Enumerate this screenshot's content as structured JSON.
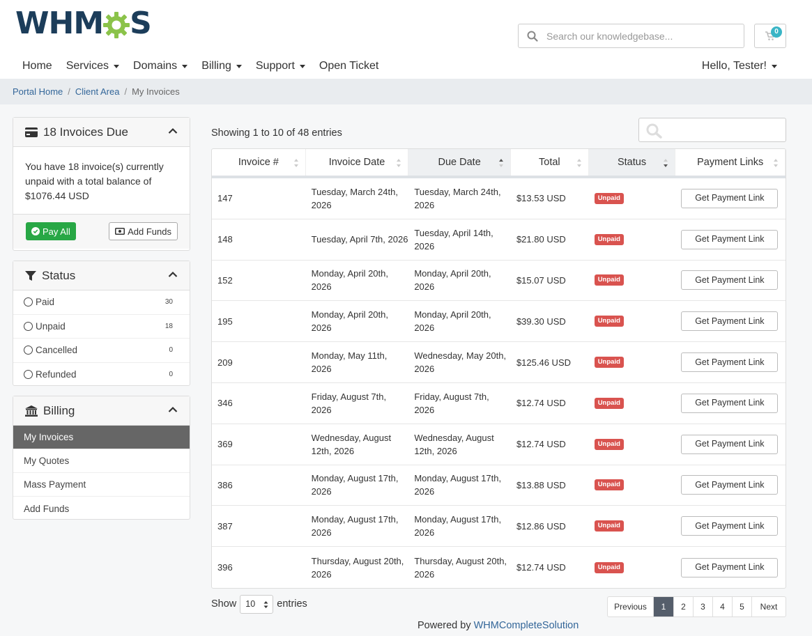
{
  "brand": {
    "logo_left": "WHM",
    "logo_right": "S",
    "logo_alt": "WHMCS"
  },
  "header": {
    "search_placeholder": "Search our knowledgebase...",
    "cart_count": "0",
    "user_menu": "Hello, Tester!"
  },
  "nav": {
    "items": [
      {
        "label": "Home",
        "dropdown": false
      },
      {
        "label": "Services",
        "dropdown": true
      },
      {
        "label": "Domains",
        "dropdown": true
      },
      {
        "label": "Billing",
        "dropdown": true
      },
      {
        "label": "Support",
        "dropdown": true
      },
      {
        "label": "Open Ticket",
        "dropdown": false
      }
    ]
  },
  "breadcrumb": {
    "items": [
      "Portal Home",
      "Client Area",
      "My Invoices"
    ]
  },
  "sidebar": {
    "due": {
      "title": "18 Invoices Due",
      "text": "You have 18 invoice(s) currently unpaid with a total balance of $1076.44 USD",
      "pay_all": "Pay All",
      "add_funds": "Add Funds"
    },
    "status": {
      "title": "Status",
      "items": [
        {
          "label": "Paid",
          "count": "30"
        },
        {
          "label": "Unpaid",
          "count": "18"
        },
        {
          "label": "Cancelled",
          "count": "0"
        },
        {
          "label": "Refunded",
          "count": "0"
        }
      ]
    },
    "billing": {
      "title": "Billing",
      "items": [
        "My Invoices",
        "My Quotes",
        "Mass Payment",
        "Add Funds"
      ]
    }
  },
  "table": {
    "showing": "Showing 1 to 10 of 48 entries",
    "headers": [
      "Invoice #",
      "Invoice Date",
      "Due Date",
      "Total",
      "Status",
      "Payment Links"
    ],
    "rows": [
      {
        "id": "147",
        "invoice_date": "Tuesday, March 24th, 2026",
        "due_date": "Tuesday, March 24th, 2026",
        "total": "$13.53 USD",
        "status": "Unpaid",
        "action": "Get Payment Link"
      },
      {
        "id": "148",
        "invoice_date": "Tuesday, April 7th, 2026",
        "due_date": "Tuesday, April 14th, 2026",
        "total": "$21.80 USD",
        "status": "Unpaid",
        "action": "Get Payment Link"
      },
      {
        "id": "152",
        "invoice_date": "Monday, April 20th, 2026",
        "due_date": "Monday, April 20th, 2026",
        "total": "$15.07 USD",
        "status": "Unpaid",
        "action": "Get Payment Link"
      },
      {
        "id": "195",
        "invoice_date": "Monday, April 20th, 2026",
        "due_date": "Monday, April 20th, 2026",
        "total": "$39.30 USD",
        "status": "Unpaid",
        "action": "Get Payment Link"
      },
      {
        "id": "209",
        "invoice_date": "Monday, May 11th, 2026",
        "due_date": "Wednesday, May 20th, 2026",
        "total": "$125.46 USD",
        "status": "Unpaid",
        "action": "Get Payment Link"
      },
      {
        "id": "346",
        "invoice_date": "Friday, August 7th, 2026",
        "due_date": "Friday, August 7th, 2026",
        "total": "$12.74 USD",
        "status": "Unpaid",
        "action": "Get Payment Link"
      },
      {
        "id": "369",
        "invoice_date": "Wednesday, August 12th, 2026",
        "due_date": "Wednesday, August 12th, 2026",
        "total": "$12.74 USD",
        "status": "Unpaid",
        "action": "Get Payment Link"
      },
      {
        "id": "386",
        "invoice_date": "Monday, August 17th, 2026",
        "due_date": "Monday, August 17th, 2026",
        "total": "$13.88 USD",
        "status": "Unpaid",
        "action": "Get Payment Link"
      },
      {
        "id": "387",
        "invoice_date": "Monday, August 17th, 2026",
        "due_date": "Monday, August 17th, 2026",
        "total": "$12.86 USD",
        "status": "Unpaid",
        "action": "Get Payment Link"
      },
      {
        "id": "396",
        "invoice_date": "Thursday, August 20th, 2026",
        "due_date": "Thursday, August 20th, 2026",
        "total": "$12.74 USD",
        "status": "Unpaid",
        "action": "Get Payment Link"
      }
    ],
    "show_label": "Show",
    "entries_label": "entries",
    "page_size": "10",
    "pagination": [
      "Previous",
      "1",
      "2",
      "3",
      "4",
      "5",
      "Next"
    ],
    "active_page": "1"
  },
  "footer": {
    "powered_by": "Powered by",
    "link": "WHMCompleteSolution"
  },
  "colors": {
    "brand_dark": "#1c3d5a",
    "brand_green": "#8bc34a",
    "unpaid": "#d9534f",
    "pay_all": "#28a745",
    "active_nav": "#666666",
    "link": "#336699"
  }
}
